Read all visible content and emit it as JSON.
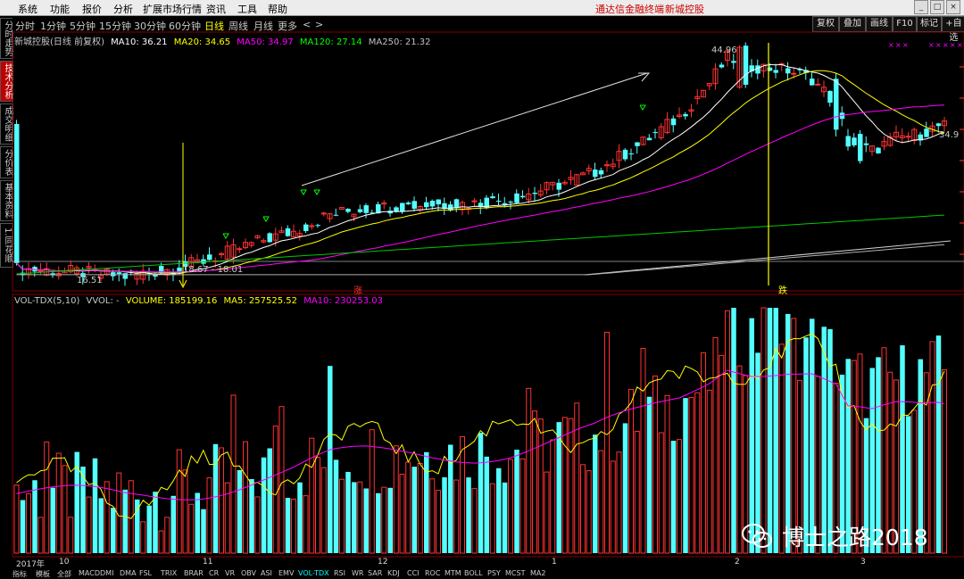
{
  "menu": {
    "items": [
      "系统",
      "功能",
      "报价",
      "分析",
      "扩展市场行情",
      "资讯",
      "工具",
      "帮助"
    ],
    "brand": "通达信金融终端",
    "stock": "新城控股",
    "win_buttons": [
      "_",
      "□",
      "×"
    ]
  },
  "periods": [
    "分时",
    "1分钟",
    "5分钟",
    "15分钟",
    "30分钟",
    "60分钟",
    "日线",
    "周线",
    "月线",
    "更多",
    "<",
    ">"
  ],
  "selected_period": "日线",
  "right_tools": [
    "复权",
    "叠加",
    "画线",
    "F10",
    "标记",
    "+自选"
  ],
  "left_tabs": [
    "分时走势",
    "技术分析",
    "成交明细",
    "分价表",
    "基本资料",
    "1.同花顺"
  ],
  "selected_left_tab": "技术分析",
  "ma": {
    "title": "新城控股(日线 前复权)",
    "items": [
      {
        "label": "MA10: 36.21",
        "color": "#ffffff"
      },
      {
        "label": "MA20: 34.65",
        "color": "#ffff00"
      },
      {
        "label": "MA50: 34.97",
        "color": "#ff00ff"
      },
      {
        "label": "MA120: 27.14",
        "color": "#00ff00"
      },
      {
        "label": "MA250: 21.32",
        "color": "#c0c0c0"
      }
    ]
  },
  "price_labels": {
    "high": "44.96",
    "low": "16.51",
    "mid": "18.67 - 18.01",
    "last": "34.9"
  },
  "markers": {
    "zhang": "涨",
    "die": "跌"
  },
  "vol": {
    "items": [
      {
        "label": "VOL-TDX(5,10)",
        "color": "#c8c8c8"
      },
      {
        "label": "VVOL: -",
        "color": "#c8c8c8"
      },
      {
        "label": "VOLUME: 185199.16",
        "color": "#ffff00"
      },
      {
        "label": "MA5: 257525.52",
        "color": "#ffff00"
      },
      {
        "label": "MA10: 230253.03",
        "color": "#ff00ff"
      }
    ]
  },
  "dates": [
    "2017年",
    "10",
    "11",
    "12",
    "1",
    "2",
    "3"
  ],
  "bottom_tabs": [
    "指标",
    "模板",
    "全部",
    "MACD",
    "DMI",
    "DMA",
    "FSL",
    "TRIX",
    "BRAR",
    "CR",
    "VR",
    "OBV",
    "ASI",
    "EMV",
    "VOL-TDX",
    "RSI",
    "WR",
    "SAR",
    "KDJ",
    "CCI",
    "ROC",
    "MTM",
    "BOLL",
    "PSY",
    "MCST",
    "MA2"
  ],
  "selected_bottom_tab": "VOL-TDX",
  "watermark": "博士之路2018",
  "colors": {
    "up": "#ff3232",
    "down": "#54ffff",
    "bg": "#000000",
    "grid": "#800000"
  }
}
